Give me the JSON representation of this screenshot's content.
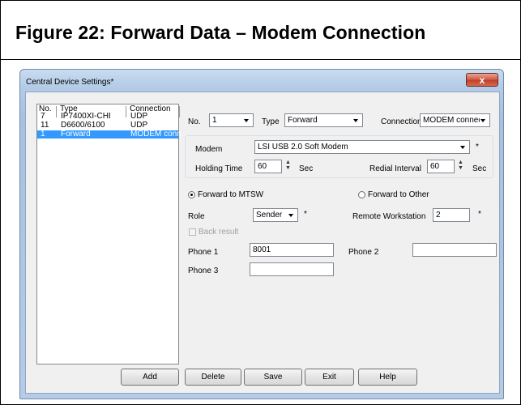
{
  "figure": {
    "title": "Figure 22:  Forward Data – Modem Connection"
  },
  "window": {
    "title": "Central Device Settings*",
    "close_glyph": "x"
  },
  "list": {
    "columns": [
      "No.",
      "Type",
      "Connection"
    ],
    "rows": [
      {
        "no": "7",
        "type": "IP7400XI-CHI",
        "connection": "UDP"
      },
      {
        "no": "11",
        "type": "D6600/6100",
        "connection": "UDP"
      },
      {
        "no": "1",
        "type": "Forward",
        "connection": "MODEM conn..."
      }
    ]
  },
  "form": {
    "no_label": "No.",
    "no_value": "1",
    "type_label": "Type",
    "type_value": "Forward",
    "connection_label": "Connection",
    "connection_value": "MODEM connec",
    "modem_label": "Modem",
    "modem_value": "LSI USB 2.0 Soft Modem",
    "modem_required": "*",
    "holding_label": "Holding Time",
    "holding_value": "60",
    "holding_unit": "Sec",
    "redial_label": "Redial Interval",
    "redial_value": "60",
    "redial_unit": "Sec",
    "forward_mtsw_label": "Forward to MTSW",
    "forward_other_label": "Forward to Other",
    "role_label": "Role",
    "role_value": "Sender",
    "role_required": "*",
    "remote_label": "Remote Workstation",
    "remote_value": "2",
    "remote_required": "*",
    "back_result_label": "Back result",
    "phone1_label": "Phone 1",
    "phone1_value": "8001",
    "phone2_label": "Phone 2",
    "phone2_value": "",
    "phone3_label": "Phone 3",
    "phone3_value": ""
  },
  "buttons": {
    "add": "Add",
    "delete": "Delete",
    "save": "Save",
    "exit": "Exit",
    "help": "Help"
  }
}
